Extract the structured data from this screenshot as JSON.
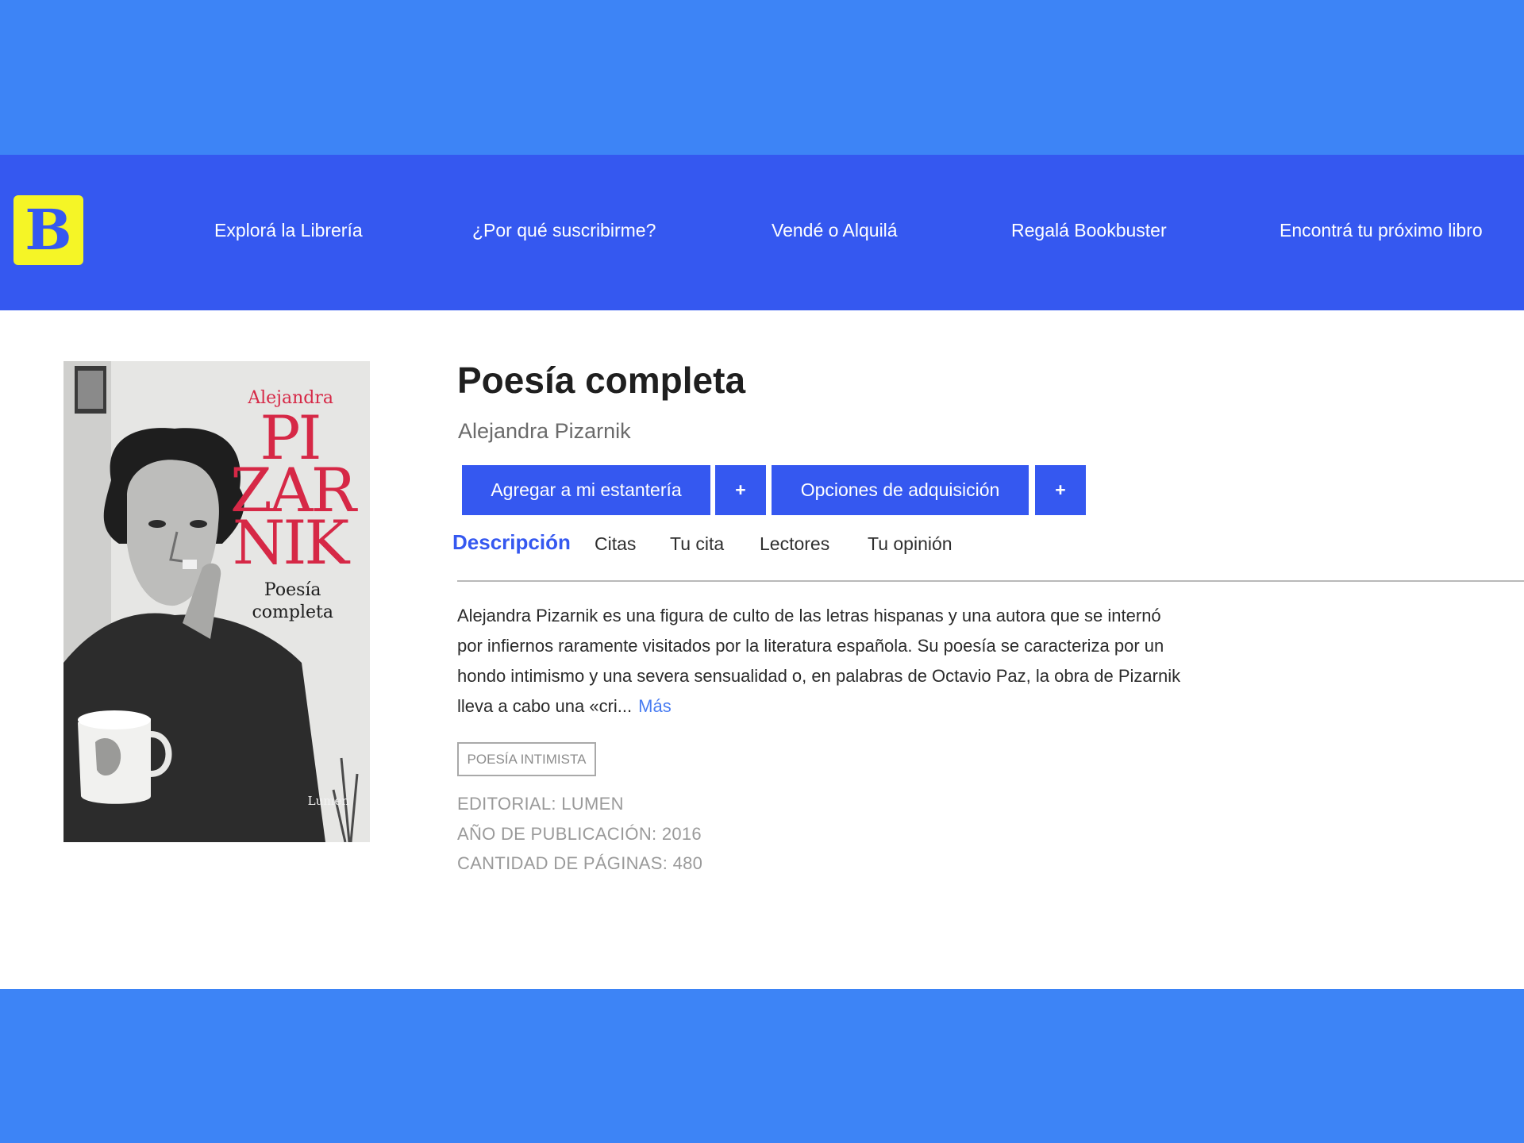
{
  "header": {
    "logo_letter": "B",
    "nav": [
      "Explorá la Librería",
      "¿Por qué suscribirme?",
      "Vendé o Alquilá",
      "Regalá Bookbuster",
      "Encontrá tu próximo libro"
    ]
  },
  "book": {
    "cover": {
      "author_first": "Alejandra",
      "author_last_lines": [
        "PI",
        "ZAR",
        "NIK"
      ],
      "subtitle_lines": [
        "Poesía",
        "completa"
      ],
      "publisher": "Lumen"
    },
    "title": "Poesía completa",
    "author": "Alejandra Pizarnik",
    "buttons": {
      "shelf": "Agregar a mi estantería",
      "plus": "+",
      "acquire": "Opciones de adquisición"
    },
    "tabs": [
      "Descripción",
      "Citas",
      "Tu cita",
      "Lectores",
      "Tu opinión"
    ],
    "description": "Alejandra Pizarnik es una figura de culto de las letras hispanas y una autora que se internó por infiernos raramente visitados por la literatura española. Su poesía se caracteriza por un hondo intimismo y una severa sensualidad o, en palabras de Octavio Paz, la obra de Pizarnik lleva a cabo una «cri...",
    "more_label": "Más",
    "tag": "POESÍA INTIMISTA",
    "meta": {
      "publisher": "EDITORIAL: LUMEN",
      "year": "AÑO DE PUBLICACIÓN: 2016",
      "pages": "CANTIDAD DE PÁGINAS: 480"
    }
  },
  "colors": {
    "background": "#3d84f6",
    "navbar": "#3558f0",
    "logo": "#f5f526",
    "accent": "#3558f0",
    "cover_red": "#d62846"
  }
}
